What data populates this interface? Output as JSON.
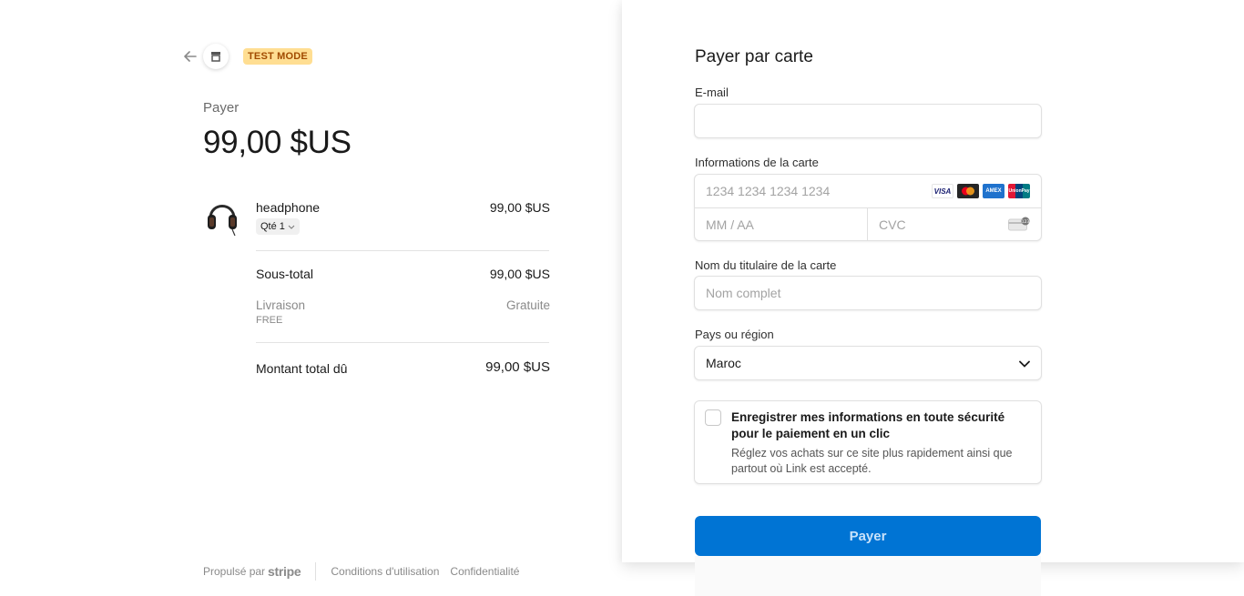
{
  "header": {
    "test_mode": "TEST MODE"
  },
  "summary": {
    "pay_label": "Payer",
    "amount": "99,00 $US",
    "item": {
      "name": "headphone",
      "price": "99,00 $US",
      "qty": "Qté 1"
    },
    "subtotal_label": "Sous-total",
    "subtotal_value": "99,00 $US",
    "shipping_label": "Livraison",
    "shipping_method": "FREE",
    "shipping_value": "Gratuite",
    "total_label": "Montant total dû",
    "total_value": "99,00 $US"
  },
  "footer": {
    "powered_by": "Propulsé par",
    "brand": "stripe",
    "terms": "Conditions d'utilisation",
    "privacy": "Confidentialité"
  },
  "form": {
    "title": "Payer par carte",
    "email_label": "E-mail",
    "email_value": "",
    "card_label": "Informations de la carte",
    "card_number_placeholder": "1234 1234 1234 1234",
    "expiry_placeholder": "MM / AA",
    "cvc_placeholder": "CVC",
    "card_brands": {
      "visa": "VISA",
      "amex": "AMEX",
      "unionpay": "UnionPay"
    },
    "name_label": "Nom du titulaire de la carte",
    "name_placeholder": "Nom complet",
    "country_label": "Pays ou région",
    "country_value": "Maroc",
    "save_title": "Enregistrer mes informations en toute sécurité pour le paiement en un clic",
    "save_desc": "Réglez vos achats sur ce site plus rapidement ainsi que partout où Link est accepté.",
    "save_checked": false,
    "pay_button": "Payer"
  },
  "colors": {
    "accent": "#0074d4",
    "test_mode_bg": "#ffde92",
    "test_mode_text": "#a14b00"
  }
}
